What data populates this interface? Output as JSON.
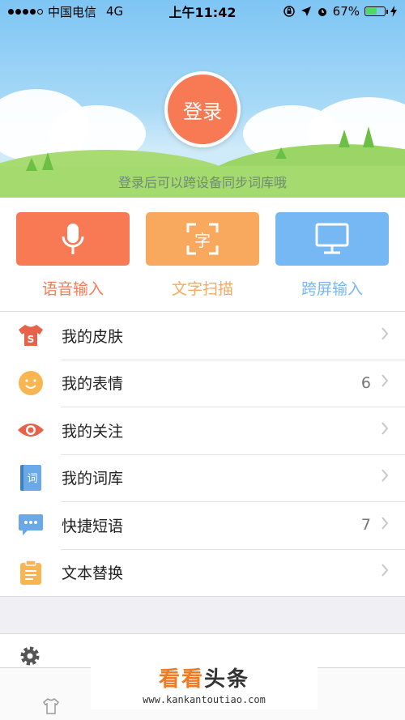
{
  "status_bar": {
    "carrier": "中国电信",
    "network": "4G",
    "time": "上午11:42",
    "battery": "67%",
    "battery_level": 0.67
  },
  "hero": {
    "login_label": "登录",
    "subtitle": "登录后可以跨设备同步词库哦"
  },
  "quick_actions": [
    {
      "label": "语音输入",
      "icon": "microphone-icon",
      "color": "#f87a55"
    },
    {
      "label": "文字扫描",
      "icon": "scan-text-icon",
      "glyph": "字",
      "color": "#f9a95e"
    },
    {
      "label": "跨屏输入",
      "icon": "monitor-icon",
      "color": "#76b8f3"
    }
  ],
  "menu": [
    {
      "label": "我的皮肤",
      "icon": "shirt-icon",
      "badge": ""
    },
    {
      "label": "我的表情",
      "icon": "smiley-icon",
      "badge": "6"
    },
    {
      "label": "我的关注",
      "icon": "eye-icon",
      "badge": ""
    },
    {
      "label": "我的词库",
      "icon": "dictionary-icon",
      "badge": ""
    },
    {
      "label": "快捷短语",
      "icon": "chat-bubble-icon",
      "badge": "7"
    },
    {
      "label": "文本替换",
      "icon": "clipboard-icon",
      "badge": ""
    }
  ],
  "dictionary_glyph": "词",
  "skin_glyph": "S",
  "watermark": {
    "brand_orange": "看看",
    "brand_dark": "头条",
    "url": "www.kankantoutiao.com"
  }
}
